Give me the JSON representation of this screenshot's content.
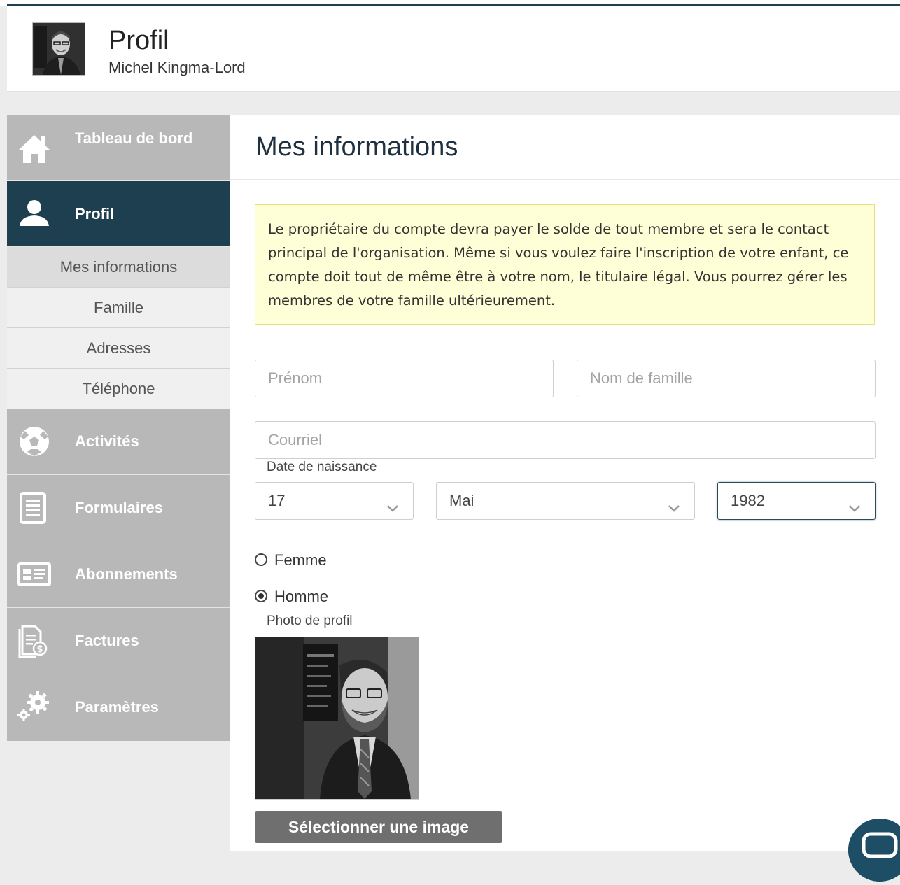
{
  "header": {
    "title": "Profil",
    "subtitle": "Michel Kingma-Lord"
  },
  "sidebar": {
    "items": [
      {
        "label": "Tableau de bord",
        "icon": "home-icon"
      },
      {
        "label": "Profil",
        "icon": "user-icon",
        "active": true
      },
      {
        "label": "Activités",
        "icon": "soccer-ball-icon"
      },
      {
        "label": "Formulaires",
        "icon": "form-icon"
      },
      {
        "label": "Abonnements",
        "icon": "membership-card-icon"
      },
      {
        "label": "Factures",
        "icon": "invoice-icon"
      },
      {
        "label": "Paramètres",
        "icon": "gears-icon"
      }
    ],
    "subitems": [
      {
        "label": "Mes informations",
        "current": true
      },
      {
        "label": "Famille"
      },
      {
        "label": "Adresses"
      },
      {
        "label": "Téléphone"
      }
    ]
  },
  "main": {
    "title": "Mes informations",
    "notice": "Le propriétaire du compte devra payer le solde de tout membre et sera le contact principal de l'organisation. Même si vous voulez faire l'inscription de votre enfant, ce compte doit tout de même être à votre nom, le titulaire légal. Vous pourrez gérer les membres de votre famille ultérieurement.",
    "form": {
      "first_name_placeholder": "Prénom",
      "last_name_placeholder": "Nom de famille",
      "email_placeholder": "Courriel",
      "birthdate_label": "Date de naissance",
      "day": "17",
      "month": "Mai",
      "year": "1982",
      "gender_options": [
        "Femme",
        "Homme"
      ],
      "gender_selected": "Homme",
      "photo_label": "Photo de profil",
      "select_image_label": "Sélectionner une image"
    }
  },
  "colors": {
    "accent": "#1d3f4f",
    "sidebar_bg": "#b8b8b8",
    "notice_bg": "#fefed7"
  }
}
